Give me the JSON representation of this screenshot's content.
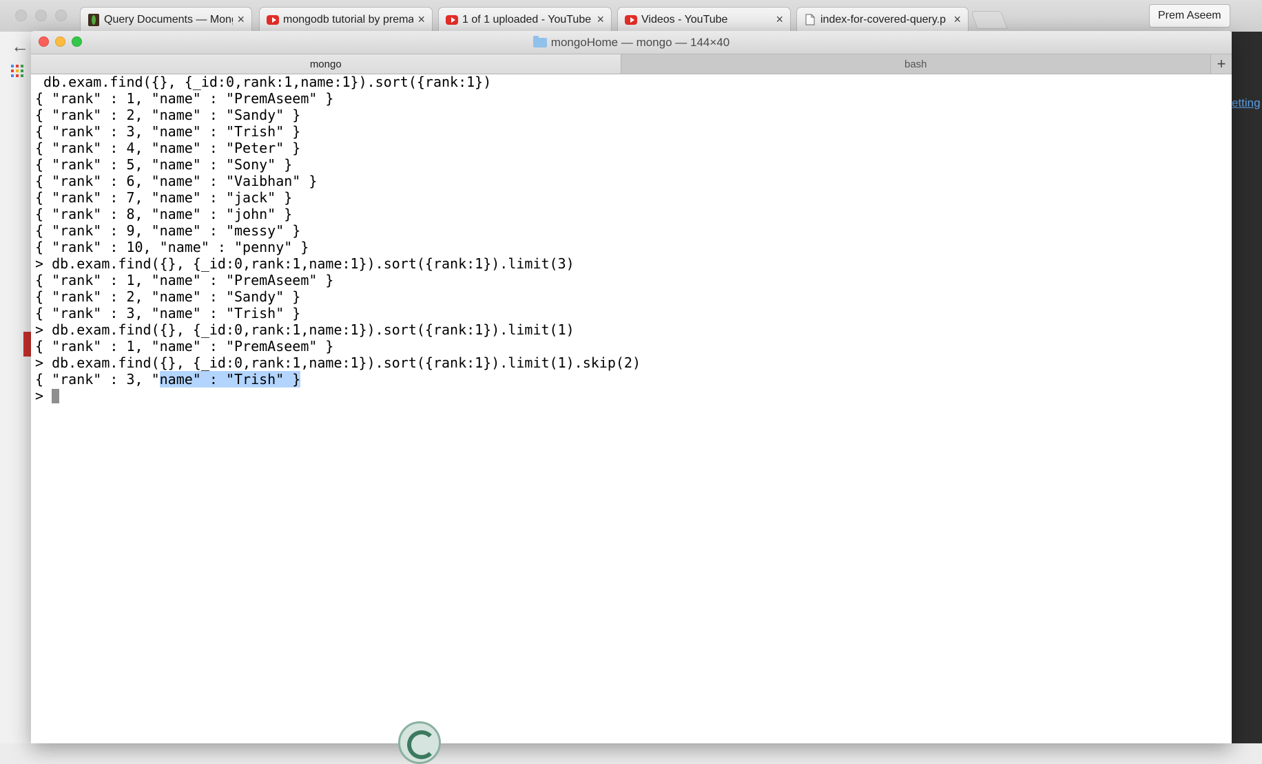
{
  "browser": {
    "tabs": [
      {
        "label": "Query Documents — Mong",
        "icon": "mongodb-leaf-icon"
      },
      {
        "label": "mongodb tutorial by prema",
        "icon": "youtube-icon"
      },
      {
        "label": "1 of 1 uploaded - YouTube",
        "icon": "youtube-icon"
      },
      {
        "label": "Videos - YouTube",
        "icon": "youtube-icon"
      },
      {
        "label": "index-for-covered-query.p",
        "icon": "document-icon"
      }
    ],
    "close_glyph": "×",
    "user_name": "Prem Aseem",
    "settings_link": "etting",
    "colors": {
      "youtube": "#e52d27",
      "link": "#5aa0e6"
    }
  },
  "terminal": {
    "title": "mongoHome — mongo — 144×40",
    "tabs": [
      {
        "label": "mongo",
        "active": true
      },
      {
        "label": "bash",
        "active": false
      }
    ],
    "add_tab": "+",
    "lines": [
      " db.exam.find({}, {_id:0,rank:1,name:1}).sort({rank:1})",
      "{ \"rank\" : 1, \"name\" : \"PremAseem\" }",
      "{ \"rank\" : 2, \"name\" : \"Sandy\" }",
      "{ \"rank\" : 3, \"name\" : \"Trish\" }",
      "{ \"rank\" : 4, \"name\" : \"Peter\" }",
      "{ \"rank\" : 5, \"name\" : \"Sony\" }",
      "{ \"rank\" : 6, \"name\" : \"Vaibhan\" }",
      "{ \"rank\" : 7, \"name\" : \"jack\" }",
      "{ \"rank\" : 8, \"name\" : \"john\" }",
      "{ \"rank\" : 9, \"name\" : \"messy\" }",
      "{ \"rank\" : 10, \"name\" : \"penny\" }",
      "> db.exam.find({}, {_id:0,rank:1,name:1}).sort({rank:1}).limit(3)",
      "{ \"rank\" : 1, \"name\" : \"PremAseem\" }",
      "{ \"rank\" : 2, \"name\" : \"Sandy\" }",
      "{ \"rank\" : 3, \"name\" : \"Trish\" }",
      "> db.exam.find({}, {_id:0,rank:1,name:1}).sort({rank:1}).limit(1)",
      "{ \"rank\" : 1, \"name\" : \"PremAseem\" }",
      "> db.exam.find({}, {_id:0,rank:1,name:1}).sort({rank:1}).limit(1).skip(2)"
    ],
    "last_output_plain": "{ \"rank\" : 3, \"",
    "last_output_selected": "name\" : \"Trish\" }",
    "prompt": "> ",
    "selection_color": "#b3d4fd"
  }
}
